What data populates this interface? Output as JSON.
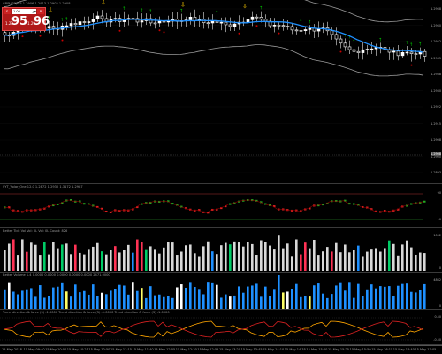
{
  "window": {
    "title": "GBPUSD,M5 1.2906 1.2913 1.2902 1.2908"
  },
  "one_click": {
    "sell_label": "S",
    "buy_label": "B",
    "lot_value": "1.00",
    "bid_prefix": "1.29",
    "bid_big": "95",
    "bid_sup": "1",
    "ask_prefix": "1.29",
    "ask_big": "96",
    "ask_sup": "1"
  },
  "price_axis": {
    "labels": [
      "1.2968",
      "1.2960",
      "1.2952",
      "1.2945",
      "1.2938",
      "1.2930",
      "1.2922",
      "1.2915",
      "1.2908",
      "1.2900",
      "1.2893"
    ],
    "current_price": "1.2908"
  },
  "indicators": {
    "rsi_title": "SYT_Volar_One 12.0 1.2872 1.2930 1.3172 1.2987",
    "rsi_levels": [
      "90",
      "10"
    ],
    "tick_title": "Better Tick Vol  Vol: 0L  Vol: 0L  Count: 826",
    "tick_levels": [
      "1052",
      "0"
    ],
    "volume_title": "Better Volume 1.4  0.0000  0.0000  0.0000  0.0000  0.0000  2471.0000",
    "volume_levels": [
      "4862",
      "0"
    ],
    "trend_title": "Trend direction & force (3) -1.0000  Trend direction & force (3) -1.0000  Trend direction & force (3) -1.0000",
    "trend_levels": [
      "0.50",
      "-0.50"
    ]
  },
  "time_axis": {
    "labels": [
      "15 May 2018",
      "15 May 09:40",
      "15 May 10:00",
      "15 May 10:25",
      "15 May 10:50",
      "15 May 11:15",
      "15 May 11:40",
      "15 May 12:05",
      "15 May 12:30",
      "15 May 12:55",
      "15 May 13:20",
      "15 May 13:45",
      "15 May 14:10",
      "15 May 14:35",
      "15 May 15:00",
      "15 May 15:25",
      "15 May 15:50",
      "15 May 16:15",
      "15 May 16:40",
      "15 May 17:05"
    ]
  },
  "colors": {
    "background": "#000000",
    "bull_candle": "#ffffff",
    "bear_candle": "#ffffff",
    "bands": "#9a9a9a",
    "ma_line": "#1e90ff",
    "up_arrow": "#00cc00",
    "down_arrow": "#cc0000",
    "signal_marker": "#ffcc00",
    "tick_bar": "#d8d8d8",
    "climax_bar": "#ff3355",
    "churn_bar": "#00cc66",
    "volume_bar": "#1e90ff",
    "trend_up": "#22aa22",
    "trend_down": "#dd2222",
    "trend_neutral": "#ffa500"
  }
}
